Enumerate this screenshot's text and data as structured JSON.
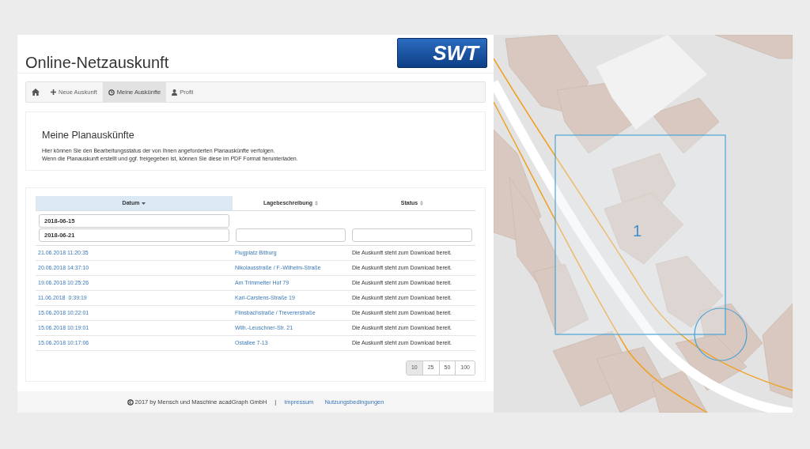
{
  "header": {
    "title": "Online-Netzauskunft",
    "logo": "SWT"
  },
  "nav": [
    {
      "kind": "home",
      "selected": false
    },
    {
      "kind": "plus",
      "label": "Neue Auskunft",
      "selected": false
    },
    {
      "kind": "clock",
      "label": "Meine Auskünfte",
      "selected": true
    },
    {
      "kind": "user",
      "label": "Profil",
      "selected": false
    }
  ],
  "intro": {
    "heading": "Meine Planauskünfte",
    "lines": [
      "Hier können Sie den Bearbeitungsstatus der von Ihnen angeforderten Planauskünfte verfolgen.",
      "Wenn die Planauskunft erstellt und ggf. freigegeben ist, können Sie diese im PDF Format herunterladen."
    ]
  },
  "table": {
    "columns": [
      {
        "label": "Datum",
        "sorted": true
      },
      {
        "label": "Lagebeschreibung",
        "sorted": false
      },
      {
        "label": "Status",
        "sorted": false
      }
    ],
    "filters": {
      "date_from": "2018-06-15",
      "date_to": "2018-06-21"
    },
    "rows": [
      {
        "date": "21.06.2018 11:20:35",
        "location": "Flugplatz Bitburg",
        "status": "Die Auskunft steht zum Download bereit."
      },
      {
        "date": "20.06.2018 14:37:10",
        "location": "Nikolausstraße / F.-Wilhelm-Straße",
        "status": "Die Auskunft steht zum Download bereit."
      },
      {
        "date": "19.06.2018 10:25:26",
        "location": "Am Trimmelter Hof 79",
        "status": "Die Auskunft steht zum Download bereit."
      },
      {
        "date": "11.06.2018  0:39:19",
        "location": "Karl-Carstens-Straße 19",
        "status": "Die Auskunft steht zum Download bereit."
      },
      {
        "date": "15.06.2018 10:22:01",
        "location": "Flinsbachstraße / Trevererstraße",
        "status": "Die Auskunft steht zum Download bereit."
      },
      {
        "date": "15.06.2018 10:19:01",
        "location": "Wilh.-Leuschner-Str. 21",
        "status": "Die Auskunft steht zum Download bereit."
      },
      {
        "date": "15.06.2018 10:17:06",
        "location": "Ostallee 7-13",
        "status": "Die Auskunft steht zum Download bereit."
      }
    ],
    "page_sizes": [
      {
        "label": "10",
        "selected": true
      },
      {
        "label": "25",
        "selected": false
      },
      {
        "label": "50",
        "selected": false
      },
      {
        "label": "100",
        "selected": false
      }
    ]
  },
  "footer": {
    "copyright": "2017 by Mensch und Maschine acadGraph GmbH",
    "separator": "|",
    "links": [
      "Impressum",
      "Nutzungsbedingungen"
    ]
  },
  "map": {
    "area_label": "1"
  }
}
